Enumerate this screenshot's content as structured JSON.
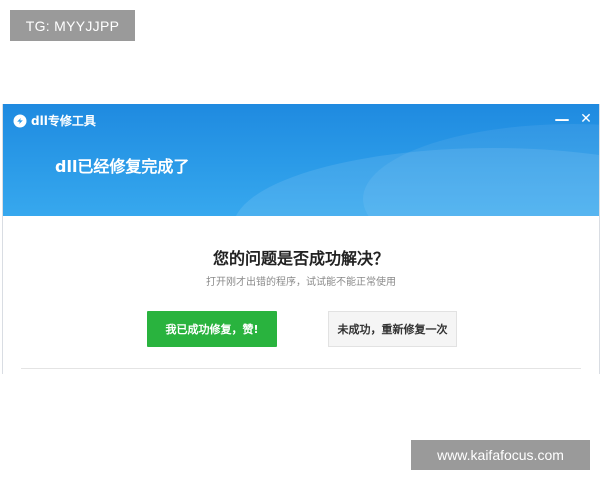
{
  "watermarks": {
    "top_left": "TG: MYYJJPP",
    "bottom_right": "www.kaifafocus.com"
  },
  "window": {
    "title": "dll专修工具",
    "logo_icon": "dll-tool-logo-icon",
    "minimize_symbol": "—",
    "close_symbol": "✕",
    "accent_color": "#2b9be8"
  },
  "banner": {
    "status_text": "dll已经修复完成了"
  },
  "main": {
    "question": "您的问题是否成功解决？",
    "hint": "打开刚才出错的程序，试试能不能正常使用",
    "success_button_label": "我已成功修复，赞!",
    "success_button_color": "#29b33e",
    "retry_button_label": "未成功，重新修复一次"
  }
}
